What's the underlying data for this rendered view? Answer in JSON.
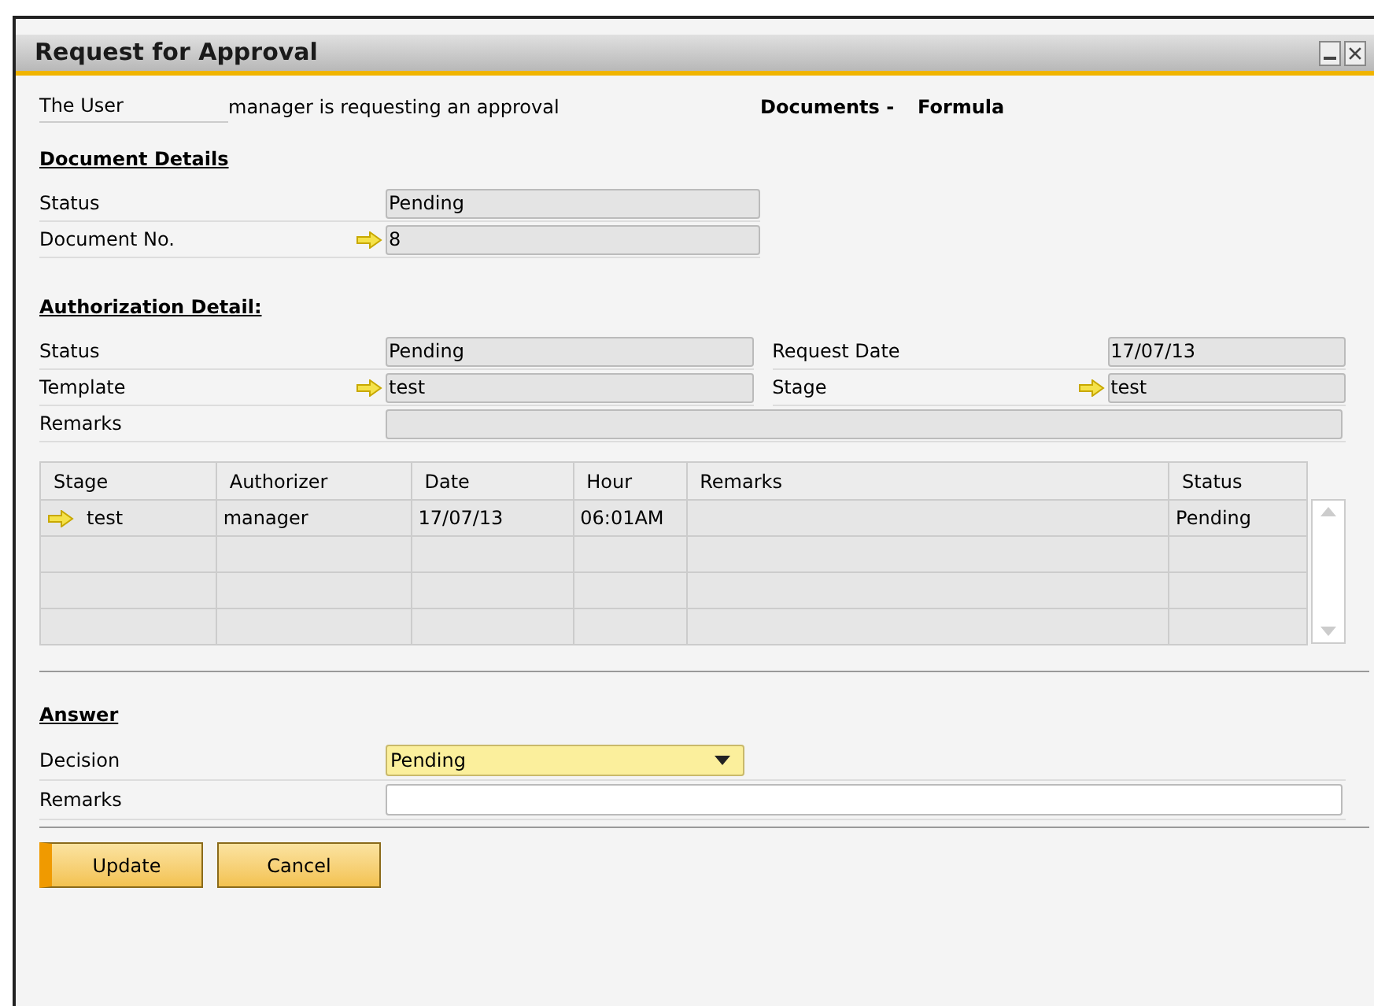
{
  "window": {
    "title": "Request for Approval"
  },
  "header": {
    "user_label": "The User",
    "user_text": "manager is requesting an approval",
    "doc_type": "Documents -",
    "doc_name": "Formula"
  },
  "document_details": {
    "title": "Document Details",
    "fields": [
      {
        "label": "Status",
        "value": "Pending",
        "link": false
      },
      {
        "label": "Document No.",
        "value": "8",
        "link": true
      }
    ]
  },
  "authorization_details": {
    "title": "Authorization Detail:",
    "left_fields": [
      {
        "label": "Status",
        "value": "Pending",
        "link": false
      },
      {
        "label": "Template",
        "value": "test",
        "link": true
      }
    ],
    "right_fields": [
      {
        "label": "Request Date",
        "value": "17/07/13",
        "link": false
      },
      {
        "label": "Stage",
        "value": "test",
        "link": true
      }
    ],
    "remarks": {
      "label": "Remarks"
    }
  },
  "table": {
    "columns": [
      "Stage",
      "Authorizer",
      "Date",
      "Hour",
      "Remarks",
      "Status"
    ],
    "rows": [
      {
        "link": true,
        "cells": [
          "test",
          "manager",
          "17/07/13",
          "06:01AM",
          "",
          "Pending"
        ]
      }
    ]
  },
  "answer": {
    "title": "Answer",
    "decision": {
      "label": "Decision",
      "value": "Pending"
    },
    "remarks": {
      "label": "Remarks"
    }
  },
  "buttons": [
    {
      "label": "Update",
      "default": true
    },
    {
      "label": "Cancel",
      "default": false
    }
  ]
}
